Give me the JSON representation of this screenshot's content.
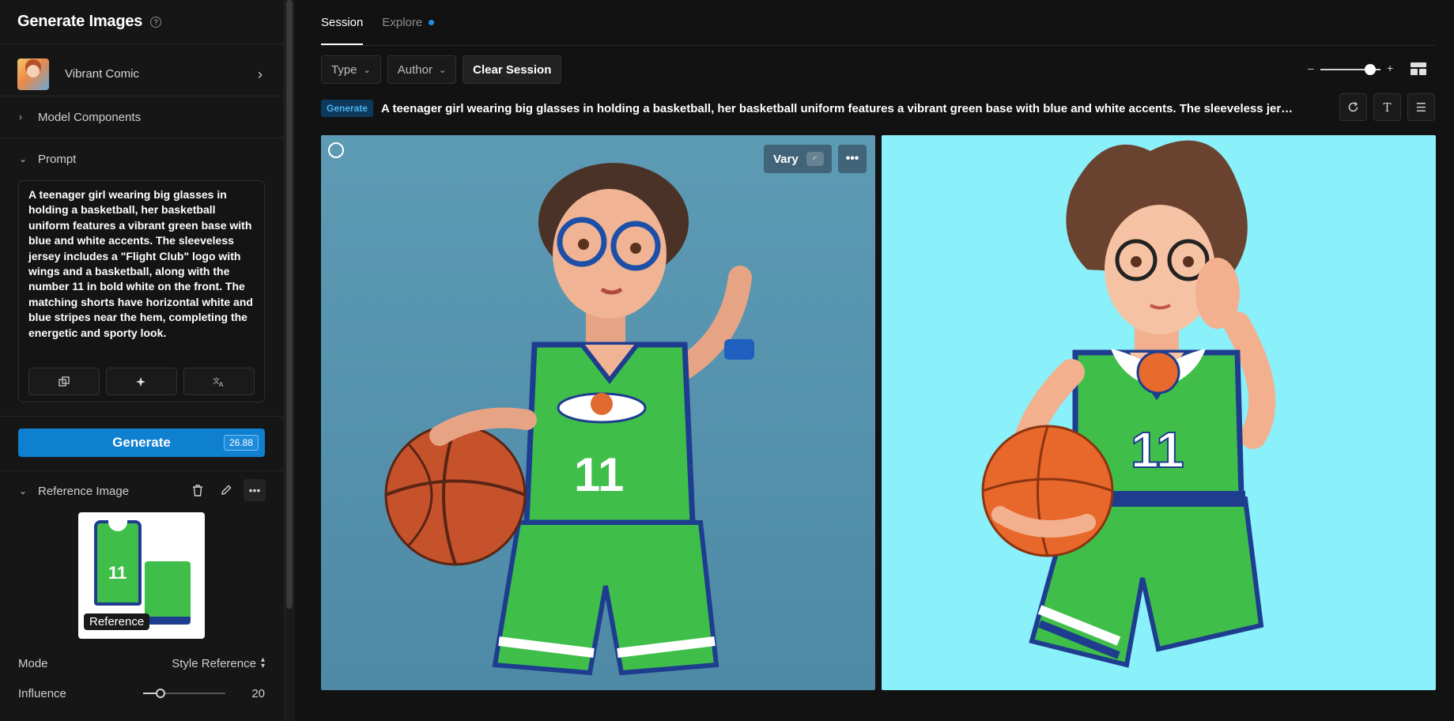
{
  "sidebar": {
    "title": "Generate Images",
    "model": {
      "name": "Vibrant Comic"
    },
    "sections": {
      "model_components": "Model Components",
      "prompt": "Prompt",
      "reference_image": "Reference Image"
    },
    "prompt_text": "A teenager girl wearing big glasses in holding a basketball, her basketball uniform features a vibrant green base with blue and white accents. The sleeveless jersey includes a \"Flight Club\" logo with wings and a basketball, along with the number 11 in bold white on the front. The matching shorts have horizontal white and blue stripes near the hem, completing the energetic and sporty look.",
    "generate_label": "Generate",
    "credits": "26.88",
    "reference_label": "Reference",
    "jersey_number": "11",
    "mode": {
      "label": "Mode",
      "value": "Style Reference"
    },
    "influence": {
      "label": "Influence",
      "value": "20",
      "level": 0.2
    }
  },
  "main": {
    "tabs": [
      {
        "label": "Session",
        "active": true
      },
      {
        "label": "Explore",
        "active": false,
        "has_dot": true
      }
    ],
    "filters": {
      "type": "Type",
      "author": "Author",
      "clear": "Clear Session"
    },
    "zoom": {
      "level": 0.75
    },
    "generate_badge": "Generate",
    "prompt_summary": "A teenager girl wearing big glasses in holding a basketball, her basketball uniform features a vibrant green base with blue and white accents. The sleeveless jersey in...",
    "vary_label": "Vary",
    "image_numbers": [
      "11",
      "11"
    ]
  },
  "colors": {
    "accent": "#0f7fd0",
    "dot": "#1f8fe5",
    "bg": "#121212",
    "img1_bg": "#5d9ab4",
    "img2_bg": "#8af0fa",
    "jersey_green": "#3fbf4a",
    "jersey_blue": "#1e3d8f"
  }
}
